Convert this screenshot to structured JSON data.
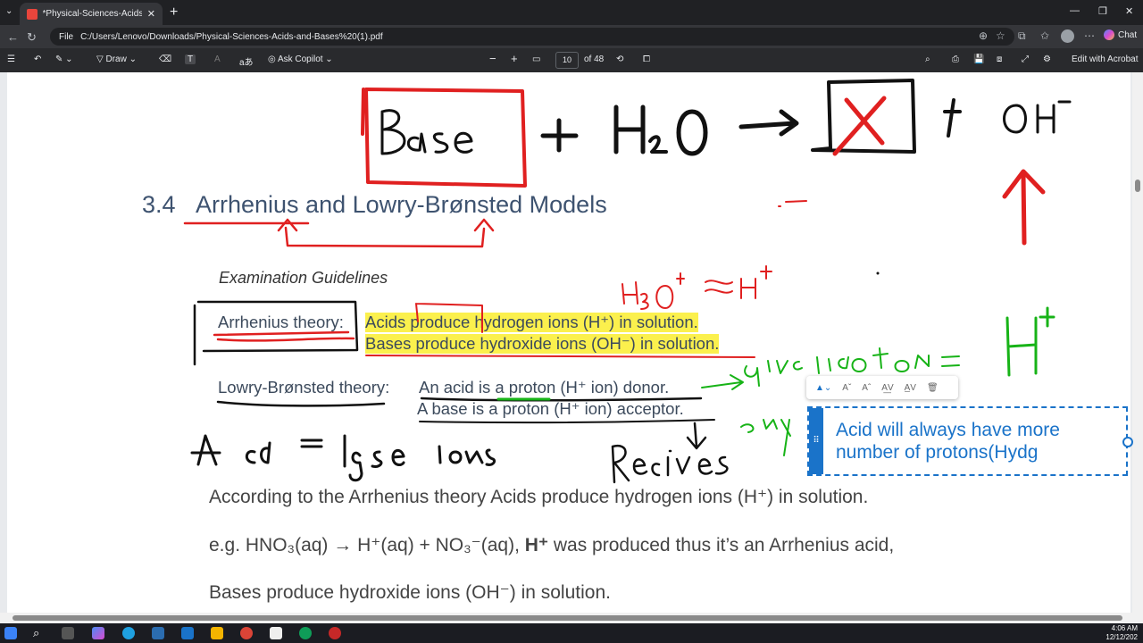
{
  "browser": {
    "tab_title": "*Physical-Sciences-Acids-and-Base",
    "tab_close": "✕",
    "new_tab": "+",
    "url_prefix": "File",
    "url": "C:/Users/Lenovo/Downloads/Physical-Sciences-Acids-and-Bases%20(1).pdf",
    "chat_label": "Chat",
    "window_controls": [
      "—",
      "❐",
      "✕"
    ]
  },
  "pdf_toolbar": {
    "draw_label": "Draw",
    "copilot_label": "Ask Copilot",
    "zoom_out": "−",
    "zoom_in": "+",
    "page_number": "10",
    "page_total": "of 48",
    "edit_label": "Edit with Acrobat"
  },
  "document": {
    "heading_number": "3.4",
    "heading_title": "Arrhenius and Lowry-Brønsted Models",
    "guidelines": "Examination Guidelines",
    "arrhenius_label": "Arrhenius theory:",
    "acid_def": "Acids produce hydrogen ions (H⁺) in solution.",
    "base_def": "Bases produce hydroxide ions (OH⁻) in solution.",
    "lowry_label": "Lowry-Brønsted theory:",
    "acid_donor": "An acid is a proton (H⁺ ion) donor.",
    "base_acceptor": "A base is a proton (H⁺ ion) acceptor.",
    "para1": "According to the Arrhenius theory Acids produce hydrogen ions (H⁺) in solution.",
    "para2_a": "e.g. HNO₃(aq) → H⁺(aq) + NO₃⁻(aq), ",
    "para2_b": "H⁺",
    "para2_c": " was produced thus it’s an Arrhenius acid,",
    "para3": "Bases produce hydroxide ions (OH⁻) in solution."
  },
  "annotation_note": {
    "text": "Acid will always have more number of protons(Hydg"
  },
  "taskbar": {
    "time": "4:06 AM",
    "date": "12/12/202"
  }
}
